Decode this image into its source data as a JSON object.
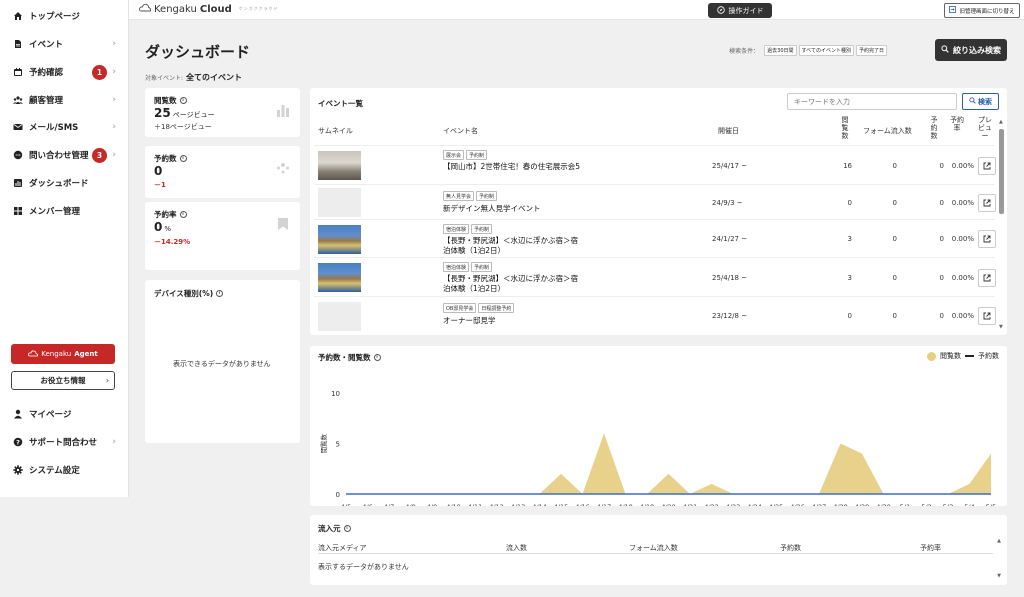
{
  "sidebar": {
    "items": [
      {
        "label": "トップページ",
        "icon": "home-icon",
        "chevron": false
      },
      {
        "label": "イベント",
        "icon": "document-icon",
        "chevron": true
      },
      {
        "label": "予約確認",
        "icon": "calendar-icon",
        "chevron": true,
        "badge": "1"
      },
      {
        "label": "顧客管理",
        "icon": "users-icon",
        "chevron": true
      },
      {
        "label": "メール/SMS",
        "icon": "mail-icon",
        "chevron": true
      },
      {
        "label": "問い合わせ管理",
        "icon": "chat-icon",
        "chevron": true,
        "badge": "3"
      },
      {
        "label": "ダッシュボード",
        "icon": "chart-icon",
        "chevron": false
      },
      {
        "label": "メンバー管理",
        "icon": "grid-icon",
        "chevron": false
      }
    ],
    "agent_button": {
      "prefix": "Kengaku",
      "suffix": "Agent"
    },
    "tips_button": "お役立ち情報",
    "bottom_items": [
      {
        "label": "マイページ",
        "icon": "person-icon",
        "chevron": false
      },
      {
        "label": "サポート問合わせ",
        "icon": "help-icon",
        "chevron": true
      },
      {
        "label": "システム設定",
        "icon": "gear-icon",
        "chevron": false
      }
    ]
  },
  "topbar": {
    "logo_prefix": "Kengaku",
    "logo_suffix": "Cloud",
    "logo_sub": "ケンガククラウド",
    "guide_button": "操作ガイド",
    "old_admin_button": "旧管理画面に切り替え"
  },
  "header": {
    "title": "ダッシュボード",
    "target_label": "対象イベント:",
    "target_value": "全てのイベント",
    "filter_label": "検索条件：",
    "filter_chips": [
      "過去30日間",
      "すべてのイベント種別",
      "予約完了日"
    ],
    "filter_button": "絞り込み検索"
  },
  "stats": {
    "views": {
      "title": "閲覧数",
      "value": "25",
      "unit": "ページビュー",
      "delta": "＋18ページビュー"
    },
    "bookings": {
      "title": "予約数",
      "value": "0",
      "delta": "－1"
    },
    "rate": {
      "title": "予約率",
      "value": "0",
      "unit": "%",
      "delta": "－14.29%"
    }
  },
  "device": {
    "title": "デバイス種別(%)",
    "empty": "表示できるデータがありません"
  },
  "events": {
    "title": "イベント一覧",
    "search_placeholder": "キーワードを入力",
    "search_button": "検索",
    "columns": {
      "thumb": "サムネイル",
      "name": "イベント名",
      "date": "開催日",
      "views": "閲覧数",
      "form": "フォーム流入数",
      "bookings": "予約数",
      "rate": "予約率",
      "preview": "プレビュー"
    },
    "rows": [
      {
        "thumb": "room",
        "tags": [
          "展示会",
          "予約制"
        ],
        "name": "【岡山市】2世帯住宅！春の住宅展示会5",
        "date": "25/4/17 ~",
        "views": "16",
        "form": "0",
        "bookings": "0",
        "rate": "0.00%"
      },
      {
        "thumb": "blank",
        "tags": [
          "無人見学会",
          "予約制"
        ],
        "name": "新デザイン無人見学イベント",
        "date": "24/9/3 ~",
        "views": "0",
        "form": "0",
        "bookings": "0",
        "rate": "0.00%"
      },
      {
        "thumb": "lake",
        "tags": [
          "宿泊体験",
          "予約制"
        ],
        "name": "【長野・野尻湖】＜水辺に浮かぶ宿＞宿泊体験（1泊2日）",
        "date": "24/1/27 ~",
        "views": "3",
        "form": "0",
        "bookings": "0",
        "rate": "0.00%"
      },
      {
        "thumb": "lake",
        "tags": [
          "宿泊体験",
          "予約制"
        ],
        "name": "【長野・野尻湖】＜水辺に浮かぶ宿＞宿泊体験（1泊2日）",
        "date": "25/4/18 ~",
        "views": "3",
        "form": "0",
        "bookings": "0",
        "rate": "0.00%"
      },
      {
        "thumb": "blank",
        "tags": [
          "OB邸見学会",
          "日程調整予約"
        ],
        "name": "オーナー邸見学",
        "date": "23/12/8 ~",
        "views": "0",
        "form": "0",
        "bookings": "0",
        "rate": "0.00%"
      }
    ]
  },
  "chart_section": {
    "title": "予約数・閲覧数",
    "legend_views": "閲覧数",
    "legend_bookings": "予約数"
  },
  "chart_data": {
    "type": "area",
    "title": "予約数・閲覧数",
    "ylabel": "閲覧数",
    "ylim": [
      0,
      10
    ],
    "yticks": [
      0,
      5,
      10
    ],
    "categories": [
      "4/5",
      "4/6",
      "4/7",
      "4/8",
      "4/9",
      "4/10",
      "4/11",
      "4/12",
      "4/13",
      "4/14",
      "4/15",
      "4/16",
      "4/17",
      "4/18",
      "4/19",
      "4/20",
      "4/21",
      "4/22",
      "4/23",
      "4/24",
      "4/25",
      "4/26",
      "4/27",
      "4/28",
      "4/29",
      "4/30",
      "5/1",
      "5/2",
      "5/3",
      "5/4",
      "5/5"
    ],
    "series": [
      {
        "name": "閲覧数",
        "type": "area",
        "color": "#e6cf85",
        "values": [
          0,
          0,
          0,
          0,
          0,
          0,
          0,
          0,
          0,
          0,
          2,
          0,
          6,
          0,
          0,
          2,
          0,
          1,
          0,
          0,
          0,
          0,
          0,
          5,
          4,
          0,
          0,
          0,
          0,
          1,
          4
        ]
      },
      {
        "name": "予約数",
        "type": "line",
        "color": "#3a6fc4",
        "values": [
          0,
          0,
          0,
          0,
          0,
          0,
          0,
          0,
          0,
          0,
          0,
          0,
          0,
          0,
          0,
          0,
          0,
          0,
          0,
          0,
          0,
          0,
          0,
          0,
          0,
          0,
          0,
          0,
          0,
          0,
          0
        ]
      }
    ],
    "legend": "top-right",
    "grid": false
  },
  "source": {
    "title": "流入元",
    "columns": [
      "流入元メディア",
      "流入数",
      "フォーム流入数",
      "予約数",
      "予約率"
    ],
    "empty": "表示するデータがありません"
  }
}
